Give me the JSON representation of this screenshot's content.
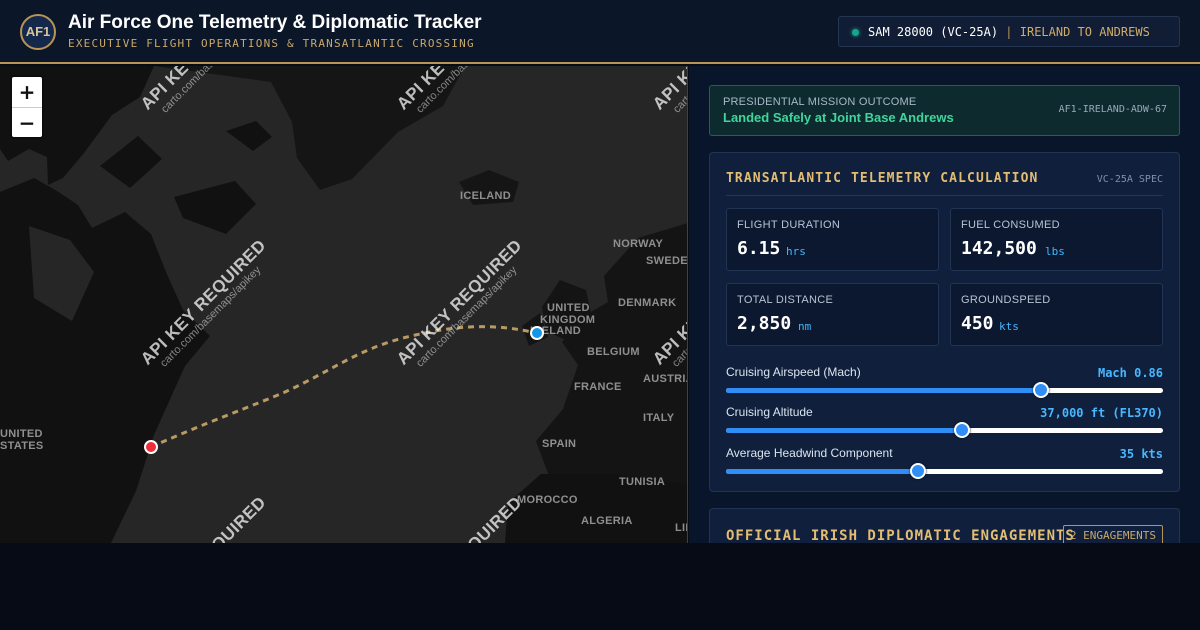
{
  "header": {
    "logo": "AF1",
    "title": "Air Force One Telemetry & Diplomatic Tracker",
    "subtitle": "EXECUTIVE FLIGHT OPERATIONS & TRANSATLANTIC CROSSING",
    "callsign": "SAM 28000 (VC-25A)",
    "separator": "|",
    "route": "IRELAND TO ANDREWS",
    "status_color": "#14A68D"
  },
  "map": {
    "zoom_in": "+",
    "zoom_out": "−",
    "watermark": "API KEY REQUIRED",
    "watermark_url": "carto.com/basemaps/apikey",
    "labels": [
      "ICELAND",
      "NORWAY",
      "SWEDEN",
      "UNITED",
      "KINGDOM",
      "IRELAND",
      "DENMARK",
      "BELGIUM",
      "FRANCE",
      "AUSTRIA",
      "ITALY",
      "SPAIN",
      "TUNISIA",
      "MOROCCO",
      "ALGERIA",
      "UNITED",
      "STATES",
      "LIBYA"
    ],
    "route_color": "#C9A86B",
    "origin_marker_color": "#1496E8",
    "destination_marker_color": "#EF2E3A"
  },
  "mission": {
    "label": "PRESIDENTIAL MISSION OUTCOME",
    "outcome": "Landed Safely at Joint Base Andrews",
    "mission_id": "AF1-IRELAND-ADW-67"
  },
  "telemetry": {
    "title": "TRANSATLANTIC TELEMETRY CALCULATION",
    "spec": "VC-25A SPEC",
    "metrics": [
      {
        "label": "FLIGHT DURATION",
        "value": "6.15",
        "unit": "hrs"
      },
      {
        "label": "FUEL CONSUMED",
        "value": "142,500",
        "unit": "lbs"
      },
      {
        "label": "TOTAL DISTANCE",
        "value": "2,850",
        "unit": "nm"
      },
      {
        "label": "GROUNDSPEED",
        "value": "450",
        "unit": "kts"
      }
    ],
    "sliders": [
      {
        "label": "Cruising Airspeed (Mach)",
        "value": "Mach 0.86",
        "level": 0.72
      },
      {
        "label": "Cruising Altitude",
        "value": "37,000 ft (FL370)",
        "level": 0.54
      },
      {
        "label": "Average Headwind Component",
        "value": "35 kts",
        "level": 0.44
      }
    ]
  },
  "engagements": {
    "title": "OFFICIAL IRISH DIPLOMATIC ENGAGEMENTS",
    "count": "2 ENGAGEMENTS"
  }
}
